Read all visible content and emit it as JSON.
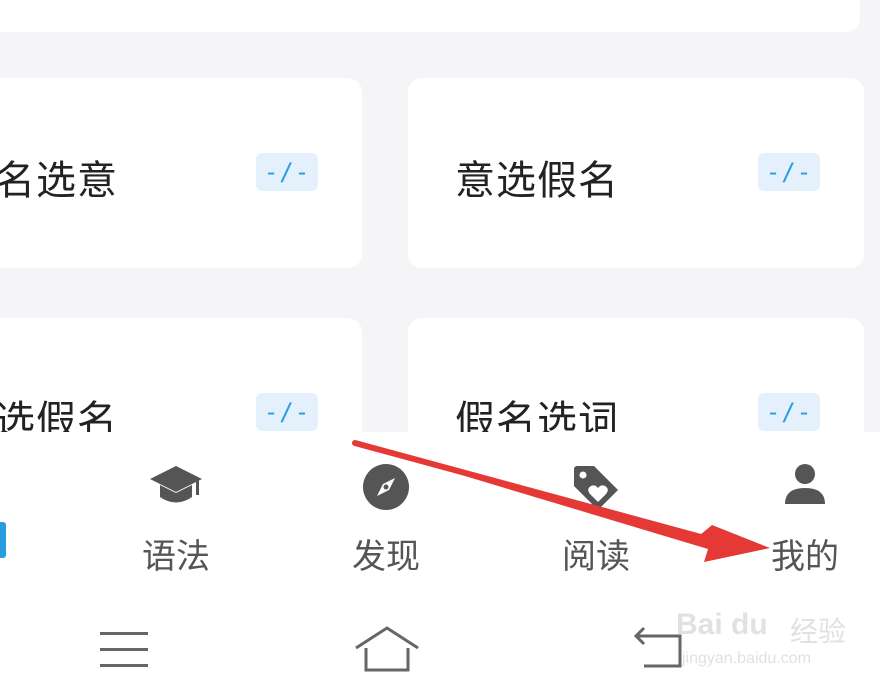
{
  "cards": [
    {
      "title": "名选意",
      "badge": "-/-"
    },
    {
      "title": "意选假名",
      "badge": "-/-"
    },
    {
      "title": "选假名",
      "badge": "-/-"
    },
    {
      "title": "假名选词",
      "badge": "-/-"
    }
  ],
  "tabbar": {
    "tabs": [
      {
        "label": "语法",
        "icon": "graduation-cap-icon"
      },
      {
        "label": "发现",
        "icon": "compass-icon"
      },
      {
        "label": "阅读",
        "icon": "heart-tag-icon"
      },
      {
        "label": "我的",
        "icon": "person-icon"
      }
    ]
  },
  "system_nav": {
    "buttons": [
      "menu-icon",
      "home-icon",
      "back-icon"
    ]
  },
  "watermark": {
    "brand_logo": "Bai du",
    "brand_zh": "经验",
    "url": "jingyan.baidu.com"
  },
  "colors": {
    "badge_text": "#2a9de0",
    "badge_bg": "#e4f0fb",
    "annotation_arrow": "#e53935",
    "icon": "#555555"
  }
}
